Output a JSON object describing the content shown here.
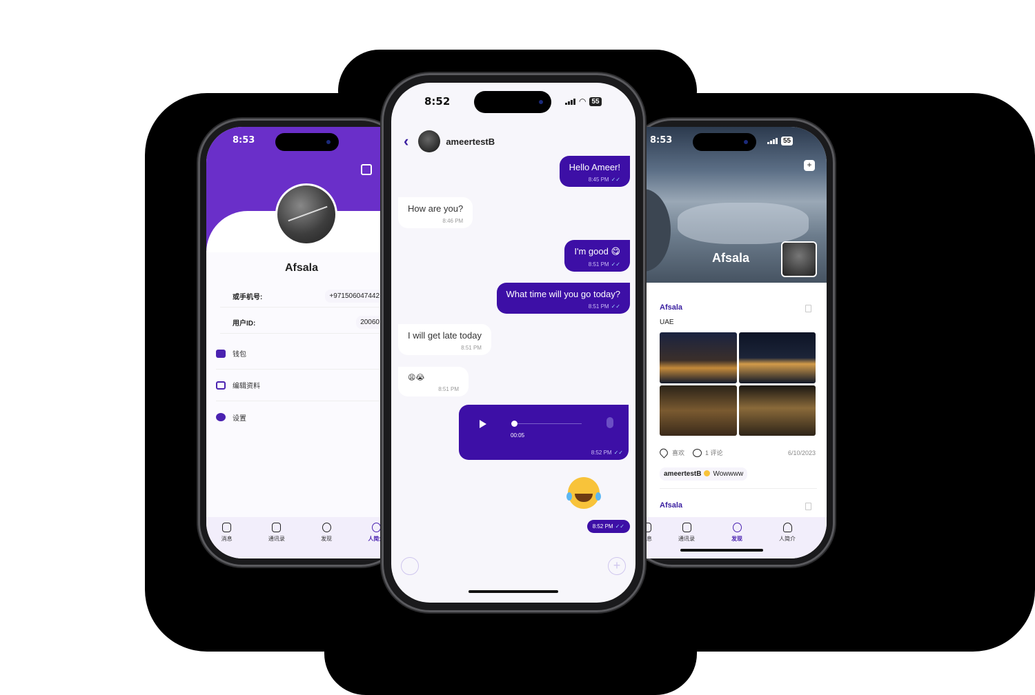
{
  "left_phone": {
    "status_time": "8:53",
    "profile_name": "Afsala",
    "fields": [
      {
        "label": "或手机号:",
        "value": "+971506047442"
      },
      {
        "label": "用户ID:",
        "value": "20060"
      }
    ],
    "menu": [
      {
        "label": "钱包",
        "icon": "wallet-icon"
      },
      {
        "label": "编辑资料",
        "icon": "edit-icon"
      },
      {
        "label": "设置",
        "icon": "gear-icon"
      }
    ],
    "nav": [
      {
        "label": "消息",
        "icon": "message-icon"
      },
      {
        "label": "通讯录",
        "icon": "contacts-icon"
      },
      {
        "label": "发现",
        "icon": "compass-icon"
      },
      {
        "label": "人简介",
        "icon": "person-icon"
      }
    ]
  },
  "center_phone": {
    "status_time": "8:52",
    "battery": "55",
    "contact_name": "ameertestB",
    "messages": [
      {
        "dir": "out",
        "text": "Hello Ameer!",
        "time": "8:45 PM"
      },
      {
        "dir": "in",
        "text": "How are you?",
        "time": "8:46 PM"
      },
      {
        "dir": "out",
        "text": "I'm good 😋",
        "time": "8:51 PM"
      },
      {
        "dir": "out",
        "text": "What time will you go today?",
        "time": "8:51 PM"
      },
      {
        "dir": "in",
        "text": "I will get late today",
        "time": "8:51 PM"
      },
      {
        "dir": "in",
        "text": "😩😭",
        "time": "8:51 PM"
      }
    ],
    "voice_message": {
      "duration": "00:05",
      "time": "8:52 PM"
    },
    "emoji_message_time": "8:52 PM"
  },
  "right_phone": {
    "status_time": "8:53",
    "battery": "55",
    "cover_name": "Afsala",
    "post": {
      "author": "Afsala",
      "text": "UAE",
      "like_label": "喜欢",
      "comment_label": "1 评论",
      "date": "6/10/2023",
      "comment_author": "ameertestB",
      "comment_text": "Wowwww"
    },
    "next_post_author": "Afsala",
    "nav": [
      {
        "label": "消息",
        "icon": "message-icon"
      },
      {
        "label": "通讯录",
        "icon": "contacts-icon"
      },
      {
        "label": "发现",
        "icon": "compass-icon"
      },
      {
        "label": "人简介",
        "icon": "person-icon"
      }
    ]
  },
  "colors": {
    "accent": "#3d0fa6",
    "header_purple": "#6a2fc9"
  }
}
